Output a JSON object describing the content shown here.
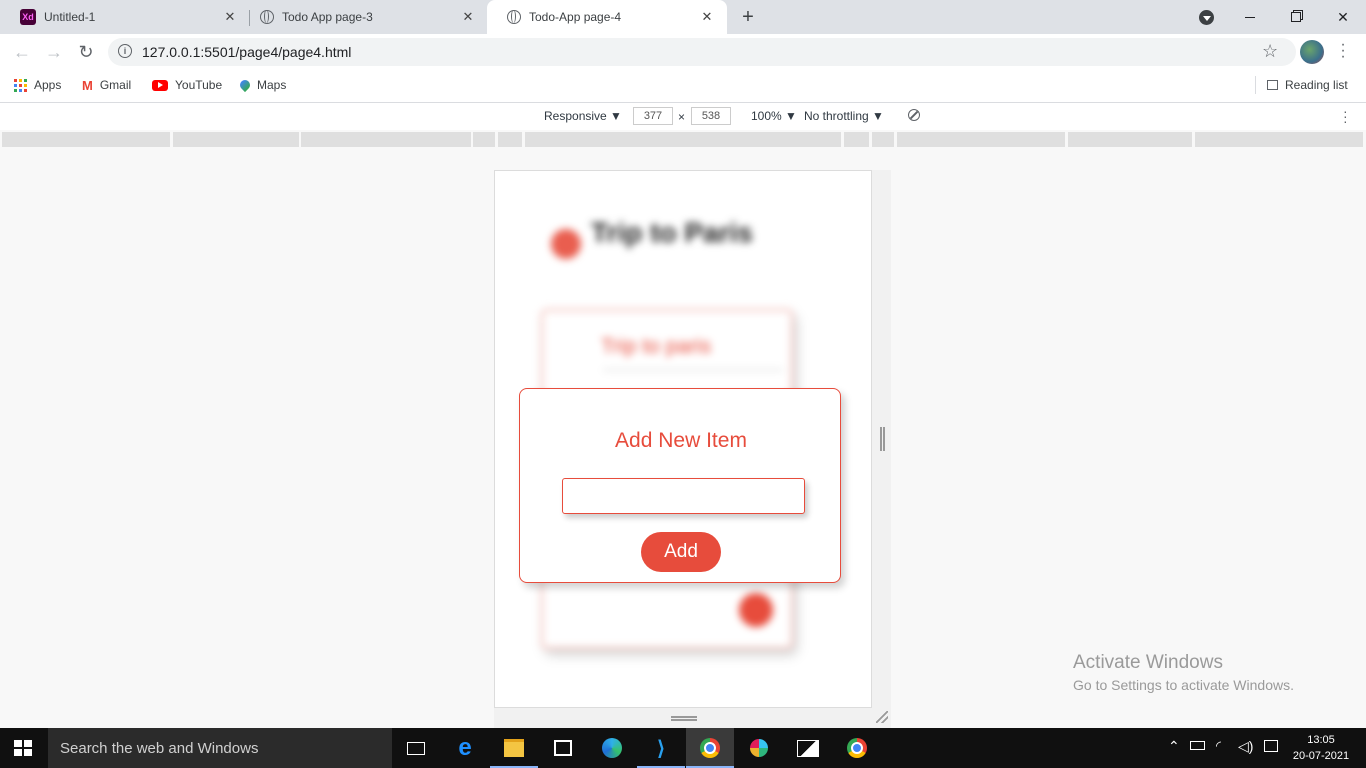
{
  "browser": {
    "tabs": [
      {
        "title": "Untitled-1",
        "icon": "adobe-xd-icon",
        "icon_text": "Xd",
        "active": false
      },
      {
        "title": "Todo App page-3",
        "icon": "globe-icon",
        "active": false
      },
      {
        "title": "Todo-App page-4",
        "icon": "globe-icon",
        "active": true
      }
    ],
    "new_tab_label": "+",
    "address": "127.0.0.1:5501/page4/page4.html",
    "bookmarks": [
      {
        "label": "Apps",
        "icon": "apps-grid-icon"
      },
      {
        "label": "Gmail",
        "icon": "gmail-icon"
      },
      {
        "label": "YouTube",
        "icon": "youtube-icon"
      },
      {
        "label": "Maps",
        "icon": "maps-pin-icon"
      }
    ],
    "reading_list_label": "Reading list"
  },
  "devtools": {
    "device": "Responsive ▼",
    "width": "377",
    "times": "×",
    "height": "538",
    "zoom": "100% ▼",
    "throttling": "No throttling ▼"
  },
  "page": {
    "blurred": {
      "heading": "Trip to Paris",
      "card_item": "Trip to paris"
    },
    "modal": {
      "title": "Add New Item",
      "input_value": "",
      "add_label": "Add"
    }
  },
  "watermark": {
    "line1": "Activate Windows",
    "line2": "Go to Settings to activate Windows."
  },
  "taskbar": {
    "search_placeholder": "Search the web and Windows",
    "time": "13:05",
    "date": "20-07-2021"
  },
  "colors": {
    "accent": "#e74c3c",
    "tab_strip": "#dee1e6",
    "taskbar": "#101010"
  }
}
